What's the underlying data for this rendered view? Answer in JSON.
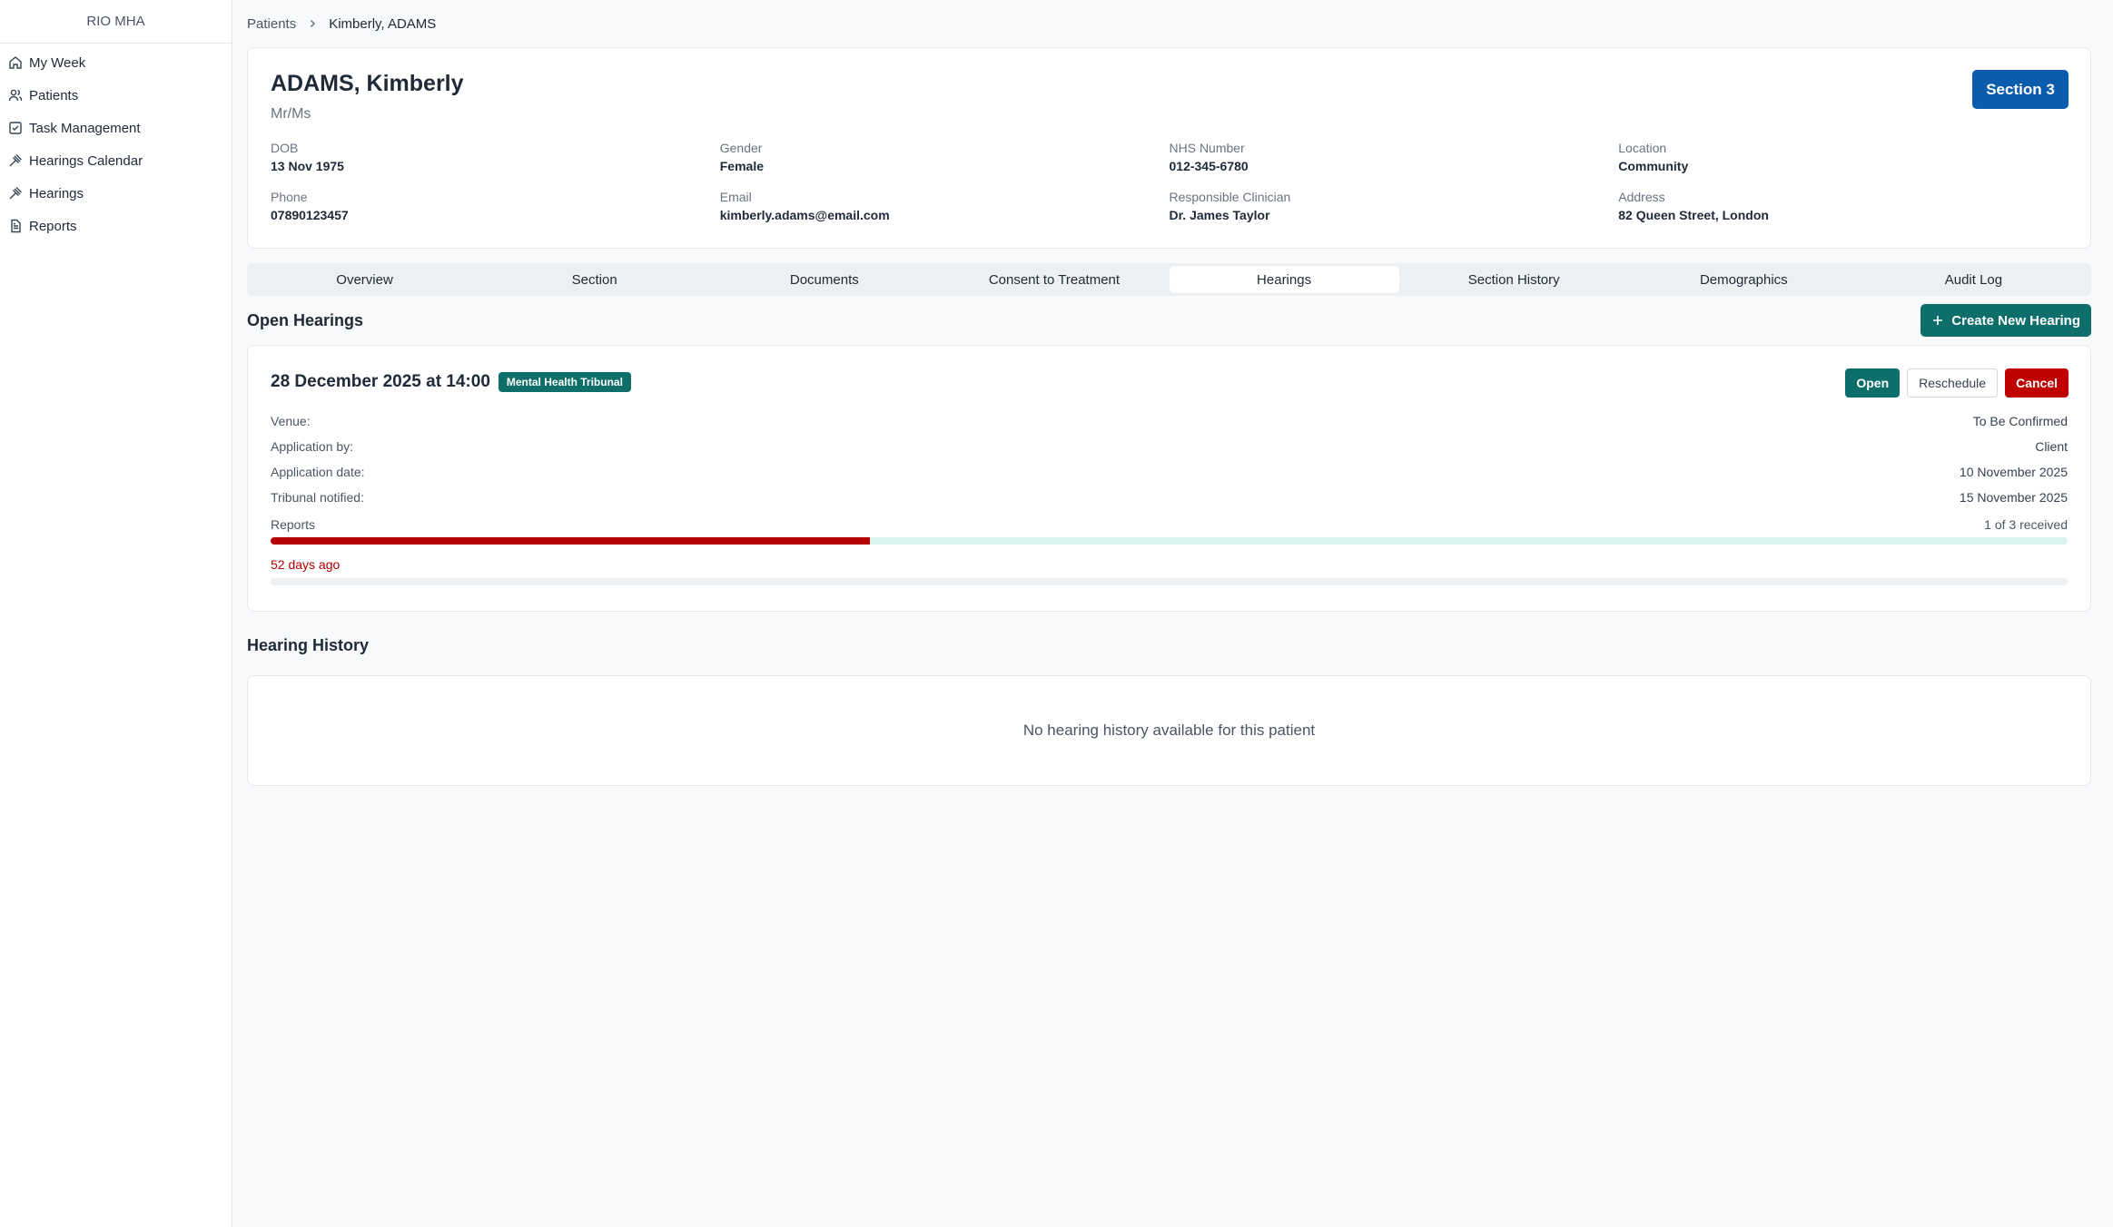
{
  "app": {
    "brand": "RIO MHA"
  },
  "sidebar": {
    "items": [
      {
        "label": "My Week",
        "icon": "home-icon"
      },
      {
        "label": "Patients",
        "icon": "users-icon"
      },
      {
        "label": "Task Management",
        "icon": "checkbox-icon"
      },
      {
        "label": "Hearings Calendar",
        "icon": "gavel-icon"
      },
      {
        "label": "Hearings",
        "icon": "gavel-icon"
      },
      {
        "label": "Reports",
        "icon": "document-icon"
      }
    ]
  },
  "breadcrumb": {
    "root": "Patients",
    "current": "Kimberly, ADAMS"
  },
  "patient": {
    "name": "ADAMS, Kimberly",
    "title": "Mr/Ms",
    "section_badge": "Section 3",
    "fields": {
      "dob": {
        "label": "DOB",
        "value": "13 Nov 1975"
      },
      "gender": {
        "label": "Gender",
        "value": "Female"
      },
      "nhs": {
        "label": "NHS Number",
        "value": "012-345-6780"
      },
      "location": {
        "label": "Location",
        "value": "Community"
      },
      "phone": {
        "label": "Phone",
        "value": "07890123457"
      },
      "email": {
        "label": "Email",
        "value": "kimberly.adams@email.com"
      },
      "clinician": {
        "label": "Responsible Clinician",
        "value": "Dr. James Taylor"
      },
      "address": {
        "label": "Address",
        "value": "82 Queen Street, London"
      }
    }
  },
  "tabs": [
    "Overview",
    "Section",
    "Documents",
    "Consent to Treatment",
    "Hearings",
    "Section History",
    "Demographics",
    "Audit Log"
  ],
  "active_tab": "Hearings",
  "open_hearings": {
    "title": "Open Hearings",
    "create_label": "Create New Hearing",
    "hearing": {
      "date": "28 December 2025 at 14:00",
      "type": "Mental Health Tribunal",
      "actions": {
        "open": "Open",
        "reschedule": "Reschedule",
        "cancel": "Cancel"
      },
      "details": {
        "venue": {
          "label": "Venue:",
          "value": "To Be Confirmed"
        },
        "application_by": {
          "label": "Application by:",
          "value": "Client"
        },
        "application_date": {
          "label": "Application date:",
          "value": "10 November 2025"
        },
        "tribunal_notified": {
          "label": "Tribunal notified:",
          "value": "15 November 2025"
        }
      },
      "reports": {
        "label": "Reports",
        "status": "1 of 3 received",
        "progress": 0.3333
      },
      "days_ago": "52 days ago"
    }
  },
  "hearing_history": {
    "title": "Hearing History",
    "empty": "No hearing history available for this patient"
  },
  "colors": {
    "accent_teal": "#0e6e6a",
    "badge_blue": "#0b5cad",
    "danger_red": "#c00000"
  }
}
